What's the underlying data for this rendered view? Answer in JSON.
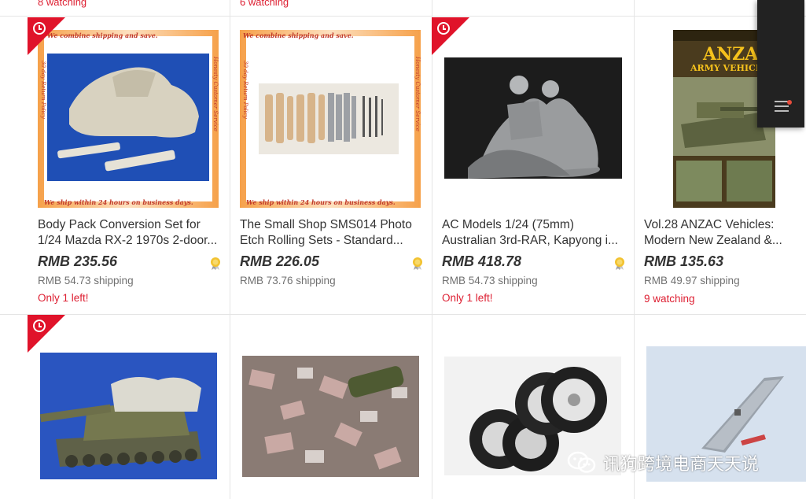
{
  "top_row": [
    {
      "watching": "8 watching"
    },
    {
      "watching": "6 watching"
    }
  ],
  "listings": [
    {
      "title_line1": "Body Pack Conversion Set for",
      "title_line2": "1/24 Mazda RX-2 1970s 2-door...",
      "price": "RMB 235.56",
      "shipping": "RMB 54.73 shipping",
      "status": "Only 1 left!",
      "banner_top": "We combine shipping and save.",
      "banner_bottom": "We ship within 24 hours on business days.",
      "banner_left": "30 day Return Policy",
      "banner_right": "Honesty Customer Service"
    },
    {
      "title_line1": "The Small Shop SMS014 Photo",
      "title_line2": "Etch Rolling Sets - Standard...",
      "price": "RMB 226.05",
      "shipping": "RMB 73.76 shipping",
      "status": "",
      "banner_top": "We combine shipping and save.",
      "banner_bottom": "We ship within 24 hours on business days.",
      "banner_left": "30 day Return Policy",
      "banner_right": "Honesty Customer Service"
    },
    {
      "title_line1": "AC Models 1/24 (75mm)",
      "title_line2": "Australian 3rd-RAR, Kapyong i...",
      "price": "RMB 418.78",
      "shipping": "RMB 54.73 shipping",
      "status": "Only 1 left!"
    },
    {
      "title_line1": "Vol.28 ANZAC Vehicles:",
      "title_line2": "Modern New Zealand &...",
      "price": "RMB 135.63",
      "shipping": "RMB 49.97 shipping",
      "status": "9 watching",
      "book_title": "ANZAC",
      "book_subtitle": "ARMY VEHICLES"
    }
  ],
  "watermark": {
    "text": "讯狗跨境电商天天说"
  },
  "colors": {
    "accent_red": "#dd1e31",
    "badge_red": "#e0132a",
    "medal_gold": "#f2c230"
  }
}
